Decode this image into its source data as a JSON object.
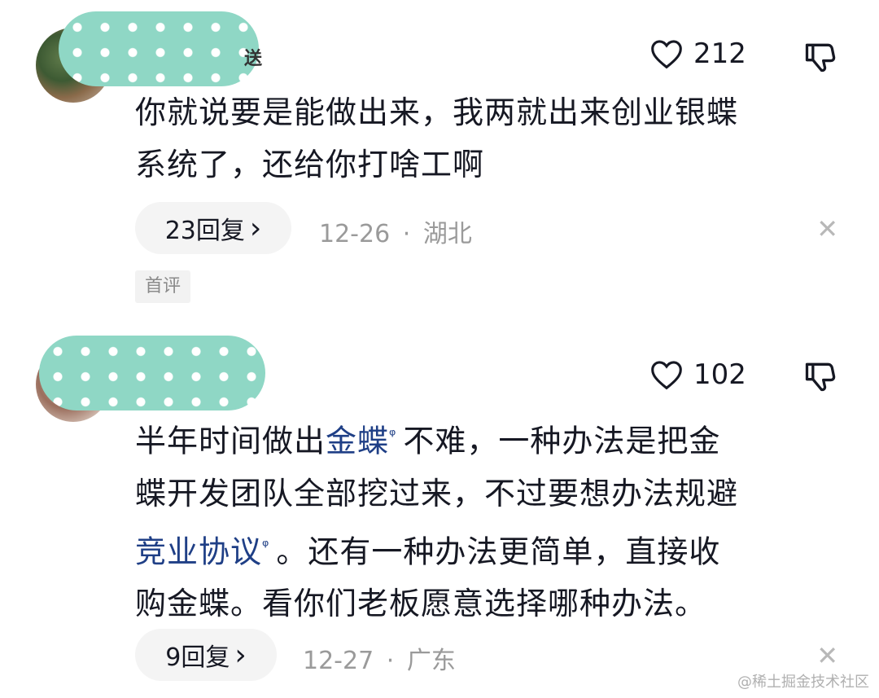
{
  "comments": [
    {
      "name_tail": "送",
      "likes": "212",
      "lines": [
        "你就说要是能做出来，我两就出来创业银蝶",
        "系统了，还给你打啥工啊"
      ],
      "replies": "23回复",
      "date": "12-26",
      "location": "湖北",
      "badge": "首评"
    },
    {
      "likes": "102",
      "line1_a": "半年时间做出",
      "line1_link": "金蝶",
      "line1_b": "不难，一种办法是把金",
      "line2": "蝶开发团队全部挖过来，不过要想办法规避",
      "line3_link": "竞业协议",
      "line3_b": "。还有一种办法更简单，直接收",
      "line4": "购金蝶。看你们老板愿意选择哪种办法。",
      "replies": "9回复",
      "date": "12-27",
      "location": "广东"
    }
  ],
  "search_glyph": "ᵠ",
  "reply_arrow": "›",
  "dot_sep": "·",
  "close_glyph": "✕",
  "watermark": "@稀土掘金技术社区",
  "icons": {
    "like": "heart-outline-icon",
    "dislike": "thumbs-down-outline-icon"
  },
  "colors": {
    "link": "#1f3f86",
    "text": "#161823",
    "meta": "#9a9a9a",
    "pill": "#f4f4f4"
  }
}
